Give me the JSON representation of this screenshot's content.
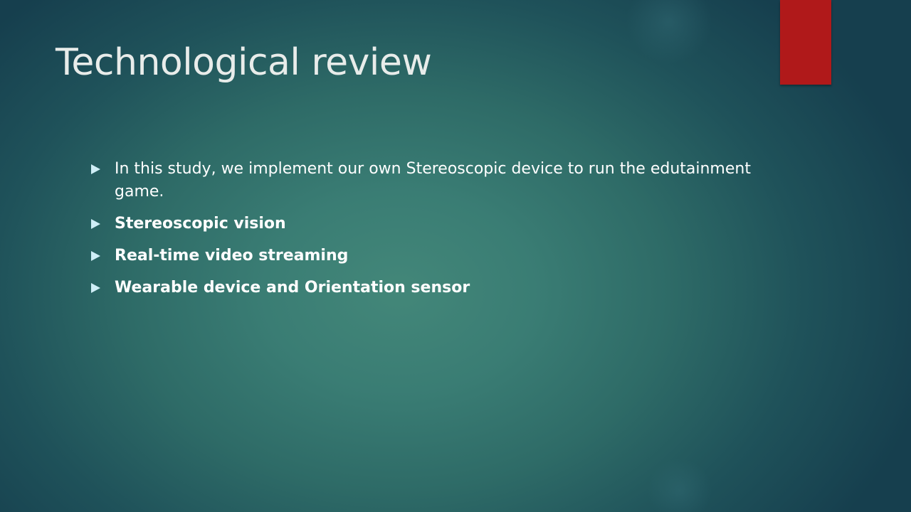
{
  "slide": {
    "title": "Technological review",
    "accent_color": "#b0191a",
    "bullet_icon": "triangle-right-icon",
    "bullets": [
      {
        "text": "In this study, we implement our own Stereoscopic device to run the edutainment game.",
        "bold": false
      },
      {
        "text": "Stereoscopic vision",
        "bold": true
      },
      {
        "text": "Real-time video streaming",
        "bold": true
      },
      {
        "text": "Wearable device and Orientation sensor",
        "bold": true
      }
    ]
  }
}
